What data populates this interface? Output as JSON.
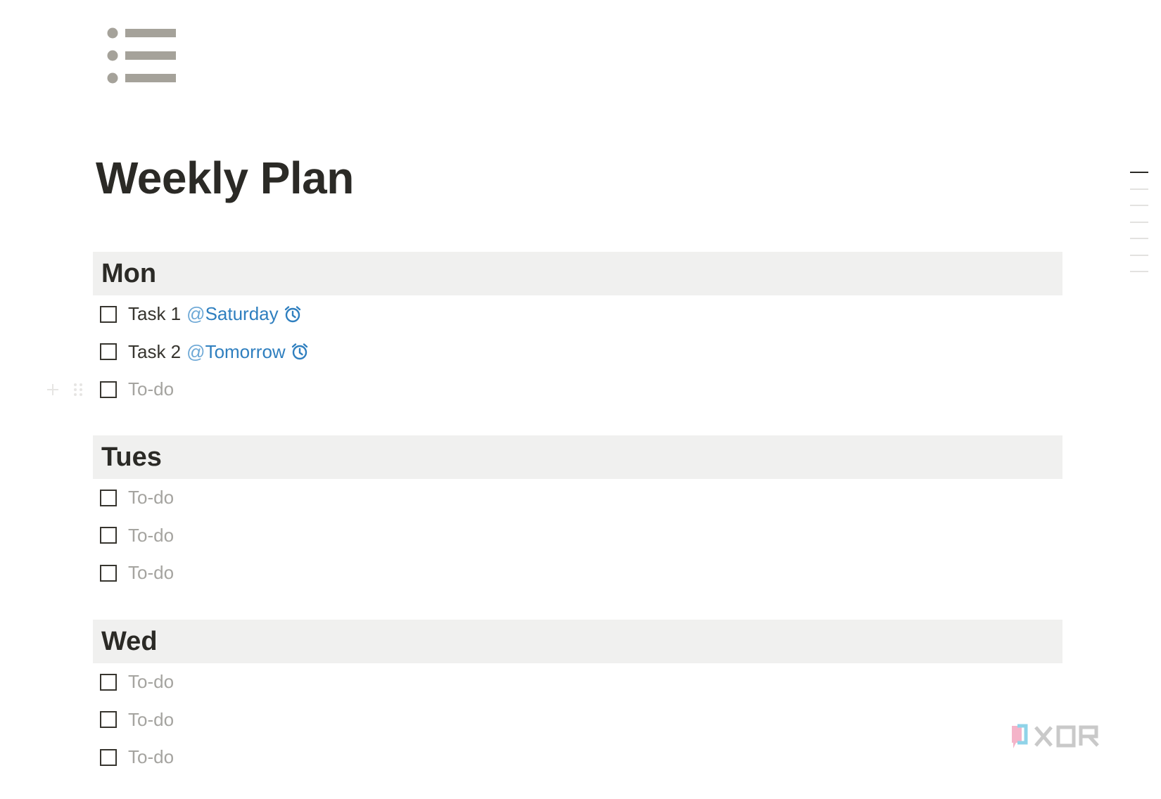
{
  "page": {
    "title": "Weekly Plan",
    "icon": "bulleted-list-icon"
  },
  "sections": [
    {
      "heading": "Mon",
      "todos": [
        {
          "text": "Task 1",
          "placeholder": false,
          "mention": {
            "at": "@",
            "label": "Saturday"
          },
          "reminder_icon": "alarm-clock-icon"
        },
        {
          "text": "Task 2",
          "placeholder": false,
          "mention": {
            "at": "@",
            "label": "Tomorrow"
          },
          "reminder_icon": "alarm-clock-icon"
        },
        {
          "text": "To-do",
          "placeholder": true
        }
      ]
    },
    {
      "heading": "Tues",
      "todos": [
        {
          "text": "To-do",
          "placeholder": true
        },
        {
          "text": "To-do",
          "placeholder": true
        },
        {
          "text": "To-do",
          "placeholder": true
        }
      ]
    },
    {
      "heading": "Wed",
      "todos": [
        {
          "text": "To-do",
          "placeholder": true
        },
        {
          "text": "To-do",
          "placeholder": true
        },
        {
          "text": "To-do",
          "placeholder": true
        }
      ]
    }
  ],
  "block_handles": {
    "add_icon": "plus-icon",
    "drag_icon": "drag-handle-icon"
  },
  "watermark": {
    "brand": "XDA"
  },
  "colors": {
    "text": "#37352f",
    "placeholder": "#a5a4a0",
    "mention": "#2f7fbf",
    "section_background": "#f0f0ef",
    "icon_gray": "#a5a29a"
  }
}
